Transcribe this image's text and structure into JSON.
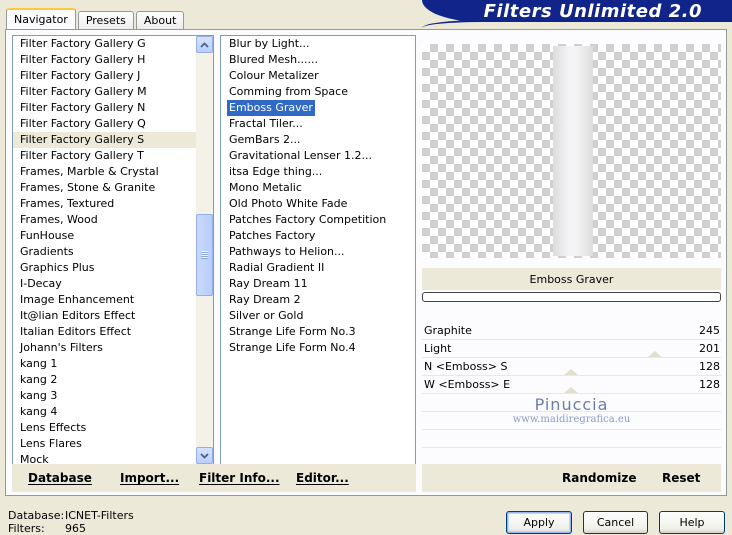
{
  "tabs": [
    "Navigator",
    "Presets",
    "About"
  ],
  "active_tab": "Navigator",
  "title": "Filters Unlimited 2.0",
  "categories": [
    "Filter Factory Gallery G",
    "Filter Factory Gallery H",
    "Filter Factory Gallery J",
    "Filter Factory Gallery M",
    "Filter Factory Gallery N",
    "Filter Factory Gallery Q",
    "Filter Factory Gallery S",
    "Filter Factory Gallery T",
    "Frames, Marble & Crystal",
    "Frames, Stone & Granite",
    "Frames, Textured",
    "Frames, Wood",
    "FunHouse",
    "Gradients",
    "Graphics Plus",
    "I-Decay",
    "Image Enhancement",
    "It@lian Editors Effect",
    "Italian Editors Effect",
    "Johann's Filters",
    "kang 1",
    "kang 2",
    "kang 3",
    "kang 4",
    "Lens Effects",
    "Lens Flares",
    "Mock"
  ],
  "selected_category": "Filter Factory Gallery S",
  "filters": [
    "Blur by Light...",
    "Blured Mesh......",
    "Colour Metalizer",
    "Comming from Space",
    "Emboss Graver",
    "Fractal Tiler...",
    "GemBars 2...",
    "Gravitational Lenser 1.2...",
    "itsa Edge thing...",
    "Mono Metalic",
    "Old Photo White Fade",
    "Patches Factory Competition",
    "Patches Factory",
    "Pathways to Helion...",
    "Radial Gradient II",
    "Ray Dream 11",
    "Ray Dream 2",
    "Silver or Gold",
    "Strange Life Form No.3",
    "Strange Life Form No.4"
  ],
  "selected_filter": "Emboss Graver",
  "filter_name": "Emboss Graver",
  "params": [
    {
      "label": "Graphite",
      "value": "245"
    },
    {
      "label": "Light",
      "value": "201"
    },
    {
      "label": "N <Emboss> S",
      "value": "128"
    },
    {
      "label": "W <Emboss> E",
      "value": "128"
    }
  ],
  "watermark": {
    "name": "Pinuccia",
    "url": "www.maidiregrafica.eu"
  },
  "actions_left": {
    "database": "Database",
    "import": "Import...",
    "filter_info": "Filter Info...",
    "editor": "Editor..."
  },
  "actions_right": {
    "randomize": "Randomize",
    "reset": "Reset"
  },
  "footer": {
    "database_label": "Database:",
    "database_value": "ICNET-Filters",
    "filters_label": "Filters:",
    "filters_value": "965"
  },
  "buttons": {
    "apply": "Apply",
    "cancel": "Cancel",
    "help": "Help"
  }
}
